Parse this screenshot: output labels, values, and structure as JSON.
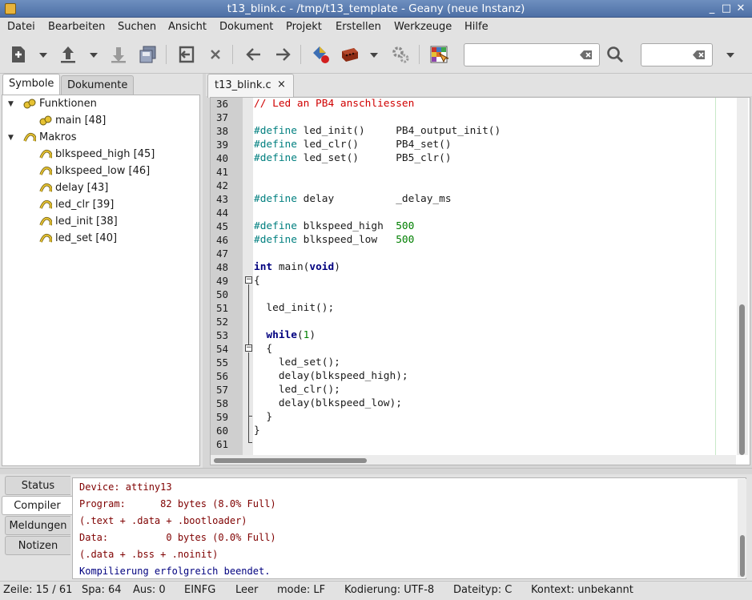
{
  "window": {
    "title": "t13_blink.c - /tmp/t13_template - Geany (neue Instanz)"
  },
  "menu": [
    "Datei",
    "Bearbeiten",
    "Suchen",
    "Ansicht",
    "Dokument",
    "Projekt",
    "Erstellen",
    "Werkzeuge",
    "Hilfe"
  ],
  "toolbar": {
    "search_value": "",
    "goto_value": "",
    "icons": [
      "new-file-icon",
      "open-file-icon",
      "save-icon",
      "save-all-icon",
      "revert-icon",
      "close-icon",
      "back-icon",
      "forward-icon",
      "compile-icon",
      "build-icon",
      "execute-icon",
      "color-chooser-icon",
      "search-icon"
    ]
  },
  "sidebar": {
    "tabs": [
      "Symbole",
      "Dokumente"
    ],
    "active_tab": "Symbole",
    "groups": [
      {
        "label": "Funktionen",
        "items": [
          "main [48]"
        ]
      },
      {
        "label": "Makros",
        "items": [
          "blkspeed_high [45]",
          "blkspeed_low [46]",
          "delay [43]",
          "led_clr [39]",
          "led_init [38]",
          "led_set [40]"
        ]
      }
    ]
  },
  "editor": {
    "tab_label": "t13_blink.c",
    "tab_close": "×",
    "lines": [
      {
        "n": "36",
        "code": [
          {
            "t": "// Led an PB4 anschliessen",
            "c": "com"
          }
        ]
      },
      {
        "n": "37",
        "code": []
      },
      {
        "n": "38",
        "code": [
          {
            "t": "#define",
            "c": "pre"
          },
          {
            "t": " led_init()     PB4_output_init()",
            "c": ""
          }
        ]
      },
      {
        "n": "39",
        "code": [
          {
            "t": "#define",
            "c": "pre"
          },
          {
            "t": " led_clr()      PB4_set()",
            "c": ""
          }
        ]
      },
      {
        "n": "40",
        "code": [
          {
            "t": "#define",
            "c": "pre"
          },
          {
            "t": " led_set()      PB5_clr()",
            "c": ""
          }
        ]
      },
      {
        "n": "41",
        "code": []
      },
      {
        "n": "42",
        "code": []
      },
      {
        "n": "43",
        "code": [
          {
            "t": "#define",
            "c": "pre"
          },
          {
            "t": " delay          _delay_ms",
            "c": ""
          }
        ]
      },
      {
        "n": "44",
        "code": []
      },
      {
        "n": "45",
        "code": [
          {
            "t": "#define",
            "c": "pre"
          },
          {
            "t": " blkspeed_high  ",
            "c": ""
          },
          {
            "t": "500",
            "c": "num"
          }
        ]
      },
      {
        "n": "46",
        "code": [
          {
            "t": "#define",
            "c": "pre"
          },
          {
            "t": " blkspeed_low   ",
            "c": ""
          },
          {
            "t": "500",
            "c": "num"
          }
        ]
      },
      {
        "n": "47",
        "code": []
      },
      {
        "n": "48",
        "code": [
          {
            "t": "int",
            "c": "kw"
          },
          {
            "t": " main(",
            "c": ""
          },
          {
            "t": "void",
            "c": "kw"
          },
          {
            "t": ")",
            "c": ""
          }
        ]
      },
      {
        "n": "49",
        "code": [
          {
            "t": "{",
            "c": ""
          }
        ]
      },
      {
        "n": "50",
        "code": []
      },
      {
        "n": "51",
        "code": [
          {
            "t": "  led_init();",
            "c": ""
          }
        ]
      },
      {
        "n": "52",
        "code": []
      },
      {
        "n": "53",
        "code": [
          {
            "t": "  ",
            "c": ""
          },
          {
            "t": "while",
            "c": "kw"
          },
          {
            "t": "(",
            "c": ""
          },
          {
            "t": "1",
            "c": "num"
          },
          {
            "t": ")",
            "c": ""
          }
        ]
      },
      {
        "n": "54",
        "code": [
          {
            "t": "  {",
            "c": ""
          }
        ]
      },
      {
        "n": "55",
        "code": [
          {
            "t": "    led_set();",
            "c": ""
          }
        ]
      },
      {
        "n": "56",
        "code": [
          {
            "t": "    delay(blkspeed_high);",
            "c": ""
          }
        ]
      },
      {
        "n": "57",
        "code": [
          {
            "t": "    led_clr();",
            "c": ""
          }
        ]
      },
      {
        "n": "58",
        "code": [
          {
            "t": "    delay(blkspeed_low);",
            "c": ""
          }
        ]
      },
      {
        "n": "59",
        "code": [
          {
            "t": "  }",
            "c": ""
          }
        ]
      },
      {
        "n": "60",
        "code": [
          {
            "t": "}",
            "c": ""
          }
        ]
      },
      {
        "n": "61",
        "code": []
      }
    ]
  },
  "bottom": {
    "tabs": [
      "Status",
      "Compiler",
      "Meldungen",
      "Notizen"
    ],
    "active_tab": "Compiler",
    "messages": [
      {
        "text": "Device: attiny13",
        "color": "dark-red"
      },
      {
        "text": "Program:      82 bytes (8.0% Full)",
        "color": "dark-red"
      },
      {
        "text": "(.text + .data + .bootloader)",
        "color": "dark-red"
      },
      {
        "text": "Data:          0 bytes (0.0% Full)",
        "color": "dark-red"
      },
      {
        "text": "(.data + .bss + .noinit)",
        "color": "dark-red"
      },
      {
        "text": "Kompilierung erfolgreich beendet.",
        "color": "blue"
      }
    ]
  },
  "statusbar": {
    "line": "Zeile: 15 / 61",
    "col": "Spa: 64",
    "sel": "Aus: 0",
    "mode_ins": "EINFG",
    "indent": "Leer",
    "eol": "mode: LF",
    "encoding": "Kodierung: UTF-8",
    "filetype": "Dateityp: C",
    "context": "Kontext: unbekannt"
  }
}
